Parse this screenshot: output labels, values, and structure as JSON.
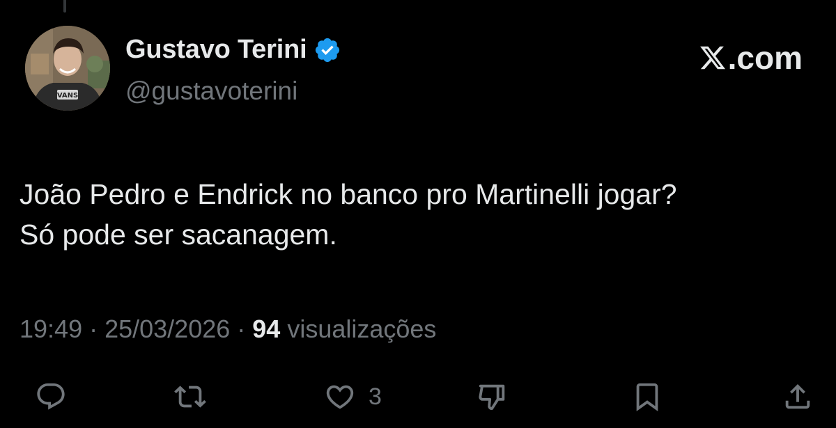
{
  "author": {
    "display_name": "Gustavo Terini",
    "handle": "@gustavoterini",
    "verified": true,
    "avatar_shirt_text": "VANS"
  },
  "brand": {
    "label": ".com",
    "logo_icon": "x-logo-icon"
  },
  "tweet": {
    "text": "João Pedro e Endrick no banco pro Martinelli jogar?\nSó pode ser sacanagem.",
    "time": "19:49",
    "date": "25/03/2026",
    "views_count": "94",
    "views_label": "visualizações"
  },
  "actions": {
    "reply": {
      "icon": "reply-icon",
      "count": ""
    },
    "retweet": {
      "icon": "retweet-icon",
      "count": ""
    },
    "like": {
      "icon": "heart-icon",
      "count": "3"
    },
    "dislike": {
      "icon": "thumbs-down-icon",
      "count": ""
    },
    "bookmark": {
      "icon": "bookmark-icon",
      "count": ""
    },
    "share": {
      "icon": "share-icon",
      "count": ""
    }
  },
  "colors": {
    "background": "#000000",
    "primary_text": "#e7e9ea",
    "secondary_text": "#71767b",
    "verified_blue": "#1d9bf0"
  }
}
